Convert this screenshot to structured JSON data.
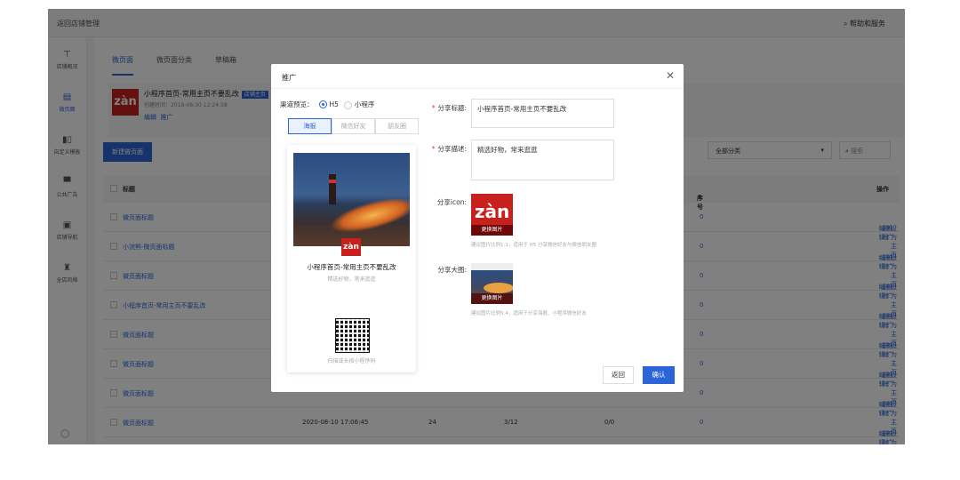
{
  "header": {
    "back": "返回店铺管理",
    "help": "帮助和服务"
  },
  "sidebar": [
    "店铺概况",
    "微页面",
    "自定义模板",
    "公共广告",
    "店铺导航",
    "全店风格"
  ],
  "tabs": [
    "微页面",
    "微页面分类",
    "草稿箱"
  ],
  "home_card": {
    "logo": "zàn",
    "title": "小程序首页-常用主页不要乱改",
    "badge": "店铺主页",
    "meta": "创建时间：2018-08-30 12:24:58",
    "actions": [
      "编辑",
      "推广"
    ]
  },
  "new_button": "新建微页面",
  "filter": {
    "category": "全部分类",
    "search_placeholder": "搜索"
  },
  "table": {
    "headers": {
      "title": "标题",
      "seq": "序号",
      "ops": "操作"
    },
    "rows": [
      {
        "title": "微页面标题",
        "seq": "0"
      },
      {
        "title": "小浣熊-微页面标题",
        "seq": "0"
      },
      {
        "title": "微页面标题",
        "seq": "0"
      },
      {
        "title": "小程序首页-常用主页不要乱改",
        "seq": "0"
      },
      {
        "title": "微页面标题",
        "seq": "0"
      },
      {
        "title": "微页面标题",
        "seq": "0"
      },
      {
        "title": "微页面标题",
        "seq": "0"
      },
      {
        "title": "微页面标题",
        "created": "2020-08-10 17:06:45",
        "visits": "24",
        "count": "3/12",
        "ratio": "0/0",
        "seq": "0"
      }
    ],
    "row_actions": [
      "编辑",
      "删除",
      "推广",
      "设为主页"
    ]
  },
  "modal": {
    "title": "推广",
    "channel_label": "渠道预览：",
    "channels": [
      "H5",
      "小程序"
    ],
    "selected_channel": "H5",
    "preview_tabs": [
      "海报",
      "微信好友",
      "朋友圈"
    ],
    "selected_preview_tab": "海报",
    "preview": {
      "logo": "zàn",
      "title": "小程序首页-常用主页不要乱改",
      "desc": "精选好物，常来逛逛",
      "qr_hint": "扫描或长按小程序码"
    },
    "share_title_label": "分享标题:",
    "share_title": "小程序首页-常用主页不要乱改",
    "share_desc_label": "分享描述:",
    "share_desc": "精选好物，常来逛逛",
    "share_icon_label": "分享icon:",
    "icon_logo": "zàn",
    "change_image": "更换图片",
    "icon_hint": "建议图片比例1:1，适用于 H5 分享微信好友与微信朋友圈",
    "share_big_label": "分享大图:",
    "big_hint": "建议图片比例5:4，适用于分享海报、小程序微信好友",
    "cancel": "返回",
    "confirm": "确认"
  },
  "colors": {
    "primary": "#2c65d8",
    "brand_red": "#c8201c",
    "required": "#e33333"
  }
}
